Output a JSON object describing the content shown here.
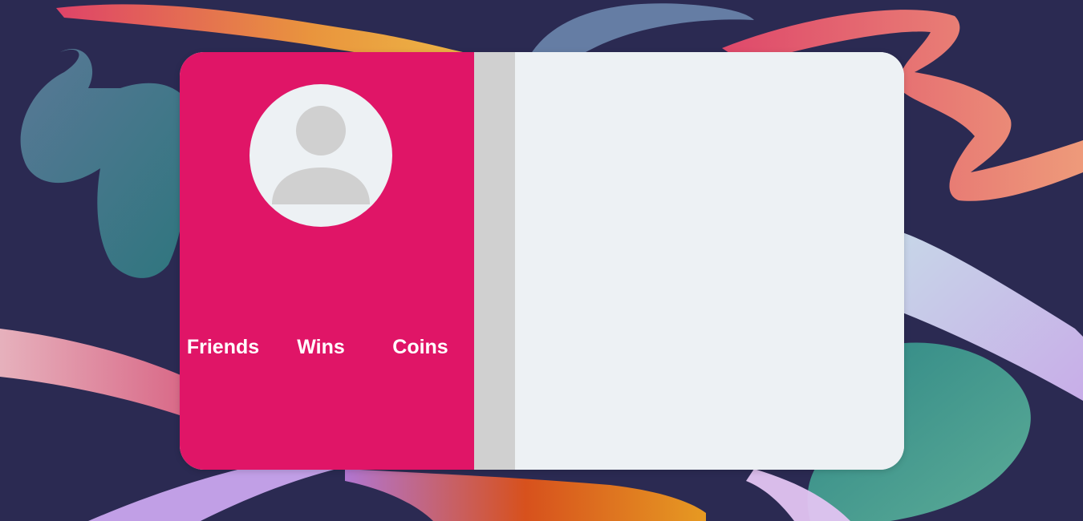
{
  "background": {
    "base_color": "#2b2a52"
  },
  "profile_card": {
    "accent_color": "#e01567",
    "avatar": {
      "icon": "user-silhouette-icon"
    },
    "stats": {
      "friends_label": "Friends",
      "wins_label": "Wins",
      "coins_label": "Coins"
    }
  }
}
